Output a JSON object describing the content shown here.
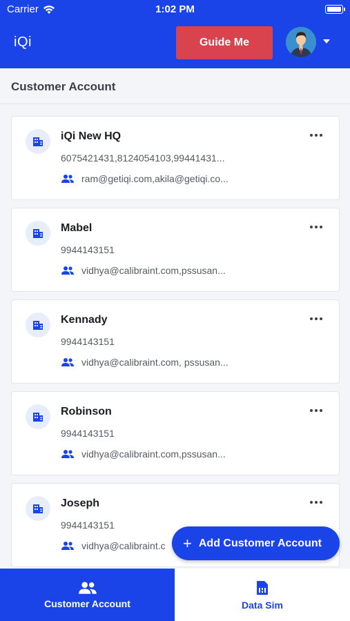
{
  "status_bar": {
    "carrier": "Carrier",
    "time": "1:02 PM"
  },
  "header": {
    "app_title": "iQi",
    "guide_label": "Guide Me"
  },
  "section": {
    "title": "Customer Account"
  },
  "accounts": [
    {
      "name": "iQi New HQ",
      "phone": "6075421431,8124054103,99441431...",
      "email": "ram@getiqi.com,akila@getiqi.co..."
    },
    {
      "name": "Mabel",
      "phone": "9944143151",
      "email": "vidhya@calibraint.com,pssusan..."
    },
    {
      "name": "Kennady",
      "phone": "9944143151",
      "email": "vidhya@calibraint.com, pssusan..."
    },
    {
      "name": "Robinson",
      "phone": "9944143151",
      "email": "vidhya@calibraint.com,pssusan..."
    },
    {
      "name": "Joseph",
      "phone": "9944143151",
      "email": "vidhya@calibraint.c"
    }
  ],
  "fab": {
    "plus": "+",
    "label": "Add Customer Account"
  },
  "bottom_nav": [
    {
      "label": "Customer Account",
      "icon": "people-icon",
      "active": true
    },
    {
      "label": "Data Sim",
      "icon": "sim-card-icon",
      "active": false
    }
  ],
  "colors": {
    "primary": "#1a44e8",
    "guide_button": "#d8434e",
    "background": "#f4f5f8"
  }
}
